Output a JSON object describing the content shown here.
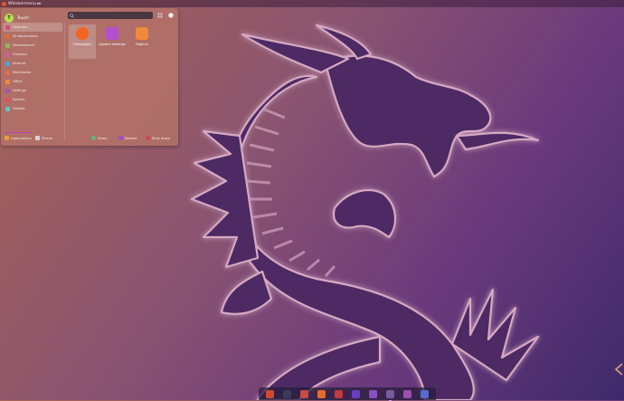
{
  "topbar": {
    "app_label": "Whiskermenu ▸▸"
  },
  "menu": {
    "username": "Touch",
    "search": {
      "placeholder": ""
    },
    "categories": [
      {
        "label": "Favorites",
        "selected": true,
        "color": "#d94c88"
      },
      {
        "label": "All Applications",
        "selected": false,
        "color": "#e36a2f"
      },
      {
        "label": "Development",
        "selected": false,
        "color": "#8cb65a"
      },
      {
        "label": "Graphics",
        "selected": false,
        "color": "#d35aa0"
      },
      {
        "label": "Internet",
        "selected": false,
        "color": "#4aa4e0"
      },
      {
        "label": "Multimedia",
        "selected": false,
        "color": "#e2704a"
      },
      {
        "label": "Office",
        "selected": false,
        "color": "#f08a3a"
      },
      {
        "label": "Settings",
        "selected": false,
        "color": "#9b59b6"
      },
      {
        "label": "System",
        "selected": false,
        "color": "#e0505a"
      },
      {
        "label": "Utilities",
        "selected": false,
        "color": "#5ac8c8"
      }
    ],
    "apps": [
      {
        "label": "Firefox/Igor",
        "selected": true,
        "color": "#f26522"
      },
      {
        "label": "System Settings",
        "selected": false,
        "color": "#b44fd0"
      },
      {
        "label": "Dolphin",
        "selected": false,
        "color": "#f08a3a"
      }
    ],
    "bottom": {
      "applications": "Applications",
      "places": "Places",
      "sleep": "Sleep",
      "restart": "Restart",
      "shutdown": "Shut down"
    }
  },
  "dock": {
    "items": [
      {
        "name": "firefox",
        "color": "#d14a2f",
        "running": false
      },
      {
        "name": "terminal",
        "color": "#3a3f58",
        "running": false
      },
      {
        "name": "files",
        "color": "#c84a45",
        "running": false
      },
      {
        "name": "browser",
        "color": "#e56b2a",
        "running": false
      },
      {
        "name": "app",
        "color": "#c2393e",
        "running": false
      },
      {
        "name": "vscode",
        "color": "#6a3ec2",
        "running": false
      },
      {
        "name": "mail",
        "color": "#8a4ec2",
        "running": false
      },
      {
        "name": "settings",
        "color": "#7a5aa0",
        "running": true
      },
      {
        "name": "store",
        "color": "#9b4fb0",
        "running": false
      },
      {
        "name": "search",
        "color": "#5a6ad0",
        "running": false
      }
    ]
  }
}
